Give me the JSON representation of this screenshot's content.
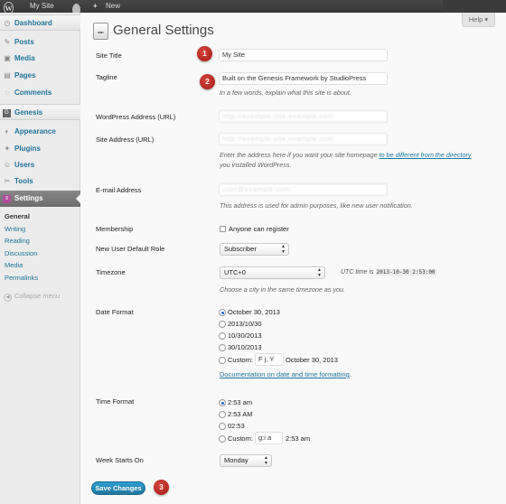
{
  "adminbar": {
    "logo": "W",
    "site_name": "My Site",
    "new_label": "New",
    "new_symbol": "+"
  },
  "sidebar": {
    "items": [
      {
        "label": "Dashboard",
        "icon": "dashboard-icon",
        "glyph": "◷"
      },
      {
        "label": "Posts",
        "icon": "pushpin-icon",
        "glyph": "✎"
      },
      {
        "label": "Media",
        "icon": "media-icon",
        "glyph": "▣"
      },
      {
        "label": "Pages",
        "icon": "pages-icon",
        "glyph": "▤"
      },
      {
        "label": "Comments",
        "icon": "comments-icon",
        "glyph": "◌"
      },
      {
        "label": "Genesis",
        "icon": "genesis-icon",
        "glyph": "G"
      },
      {
        "label": "Appearance",
        "icon": "appearance-icon",
        "glyph": "◐"
      },
      {
        "label": "Plugins",
        "icon": "plugins-icon",
        "glyph": "✦"
      },
      {
        "label": "Users",
        "icon": "users-icon",
        "glyph": "☺"
      },
      {
        "label": "Tools",
        "icon": "tools-icon",
        "glyph": "✂"
      },
      {
        "label": "Settings",
        "icon": "settings-icon",
        "glyph": "≡"
      }
    ],
    "submenu": [
      "General",
      "Writing",
      "Reading",
      "Discussion",
      "Media",
      "Permalinks"
    ],
    "collapse_label": "Collapse menu"
  },
  "help_label": "Help ▾",
  "page_title": "General Settings",
  "badges": [
    "1",
    "2",
    "3"
  ],
  "fields": {
    "site_title": {
      "label": "Site Title",
      "value": "My Site"
    },
    "tagline": {
      "label": "Tagline",
      "value": "Built on the Genesis Framework by StudioPress",
      "desc": "In a few words, explain what this site is about."
    },
    "wp_address": {
      "label": "WordPress Address (URL)",
      "value": "http://example-site.example.com"
    },
    "site_address": {
      "label": "Site Address (URL)",
      "value": "http://example-site.example.com",
      "desc_pre": "Enter the address here if you want your site homepage ",
      "desc_link": "to be different from the directory",
      "desc_post": "you installed WordPress."
    },
    "email": {
      "label": "E-mail Address",
      "value": "user@example.com",
      "desc": "This address is used for admin purposes, like new user notification."
    },
    "membership": {
      "label": "Membership",
      "option": "Anyone can register"
    },
    "default_role": {
      "label": "New User Default Role",
      "value": "Subscriber"
    },
    "timezone": {
      "label": "Timezone",
      "value": "UTC+0",
      "utc_prefix": "UTC time is",
      "utc_time": "2013-10-30 2:53:00",
      "desc": "Choose a city in the same timezone as you."
    },
    "date_format": {
      "label": "Date Format",
      "options": [
        "October 30, 2013",
        "2013/10/30",
        "10/30/2013",
        "30/10/2013"
      ],
      "custom_label": "Custom:",
      "custom_value": "F j, Y",
      "custom_preview": "October 30, 2013",
      "doc_link": "Documentation on date and time formatting",
      "doc_suffix": "."
    },
    "time_format": {
      "label": "Time Format",
      "options": [
        "2:53 am",
        "2:53 AM",
        "02:53"
      ],
      "custom_label": "Custom:",
      "custom_value": "g:i a",
      "custom_preview": "2:53 am"
    },
    "week_starts": {
      "label": "Week Starts On",
      "value": "Monday"
    }
  },
  "save_label": "Save Changes",
  "colors": {
    "accent": "#21759b",
    "badge": "#c0302a",
    "settings_icon": "#b44b9d"
  }
}
